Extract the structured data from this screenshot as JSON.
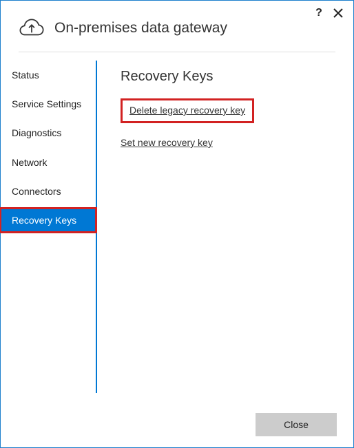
{
  "header": {
    "title": "On-premises data gateway"
  },
  "sidebar": {
    "items": [
      {
        "label": "Status"
      },
      {
        "label": "Service Settings"
      },
      {
        "label": "Diagnostics"
      },
      {
        "label": "Network"
      },
      {
        "label": "Connectors"
      },
      {
        "label": "Recovery Keys"
      }
    ]
  },
  "content": {
    "heading": "Recovery Keys",
    "delete_legacy_label": "Delete legacy recovery key",
    "set_new_label": "Set new recovery key"
  },
  "footer": {
    "close_label": "Close"
  }
}
